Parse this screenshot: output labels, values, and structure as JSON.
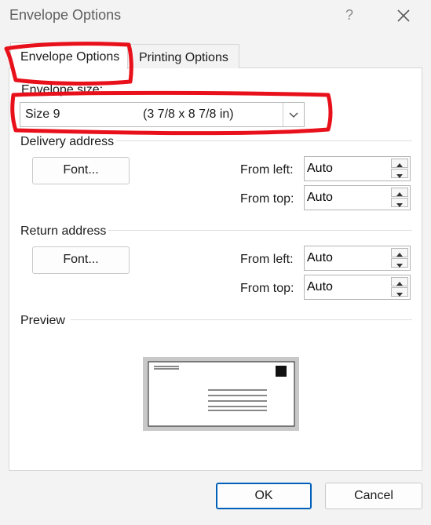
{
  "window": {
    "title": "Envelope Options",
    "help_label": "?",
    "close_icon": "close-icon"
  },
  "tabs": [
    {
      "label": "Envelope Options",
      "active": true
    },
    {
      "label": "Printing Options",
      "active": false
    }
  ],
  "envelope_size": {
    "label": "Envelope size:",
    "value": "Size 9",
    "dimensions": "(3 7/8 x 8 7/8 in)"
  },
  "delivery_address": {
    "heading": "Delivery address",
    "font_button": "Font...",
    "from_left_label": "From left:",
    "from_left_value": "Auto",
    "from_top_label": "From top:",
    "from_top_value": "Auto"
  },
  "return_address": {
    "heading": "Return address",
    "font_button": "Font...",
    "from_left_label": "From left:",
    "from_left_value": "Auto",
    "from_top_label": "From top:",
    "from_top_value": "Auto"
  },
  "preview": {
    "heading": "Preview"
  },
  "footer": {
    "ok_label": "OK",
    "cancel_label": "Cancel"
  },
  "colors": {
    "annotation": "#e8101a",
    "accent": "#005fb8"
  }
}
